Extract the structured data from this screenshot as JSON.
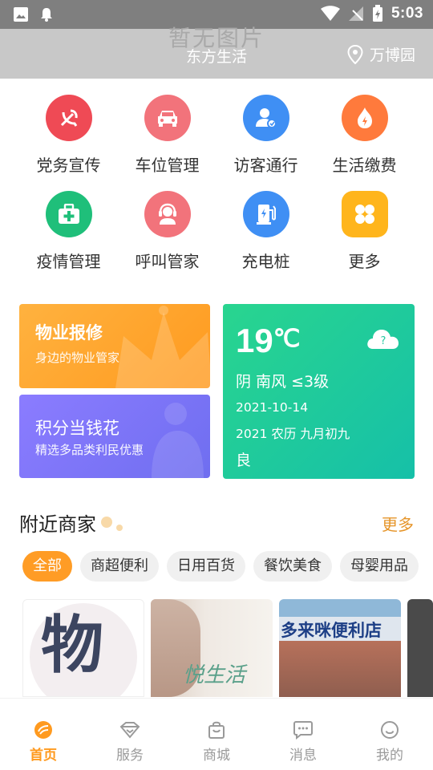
{
  "status_bar": {
    "time": "5:03"
  },
  "header": {
    "placeholder": "暂无图片",
    "title": "东方生活",
    "location": "万博园"
  },
  "grid": [
    {
      "label": "党务宣传",
      "icon": "party-emblem-icon",
      "color": "#ef4a55"
    },
    {
      "label": "车位管理",
      "icon": "car-icon",
      "color": "#f2737b"
    },
    {
      "label": "访客通行",
      "icon": "visitor-icon",
      "color": "#3f8ff4"
    },
    {
      "label": "生活缴费",
      "icon": "fire-icon",
      "color": "#ff7a3c"
    },
    {
      "label": "疫情管理",
      "icon": "medical-kit-icon",
      "color": "#1fbf7a"
    },
    {
      "label": "呼叫管家",
      "icon": "headset-icon",
      "color": "#f2737b"
    },
    {
      "label": "充电桩",
      "icon": "charger-icon",
      "color": "#3f8ff4"
    },
    {
      "label": "更多",
      "icon": "apps-icon",
      "color": "#ffb51c"
    }
  ],
  "cards": {
    "repair": {
      "title": "物业报修",
      "subtitle": "身边的物业管家"
    },
    "points": {
      "title": "积分当钱花",
      "subtitle": "精选多品类利民优惠"
    },
    "weather": {
      "temp": "19",
      "unit": "℃",
      "desc": "阴 南风 ≤3级",
      "date": "2021-10-14",
      "lunar": "2021 农历 九月初九",
      "quality": "良",
      "icon": "cloud-question-icon"
    }
  },
  "nearby": {
    "title": "附近商家",
    "more": "更多",
    "chips": [
      "全部",
      "商超便利",
      "日用百货",
      "餐饮美食",
      "母婴用品"
    ],
    "shops": [
      {
        "caption": "物"
      },
      {
        "caption": "悦生活"
      },
      {
        "caption": "多来咪便利店"
      }
    ]
  },
  "tabs": [
    {
      "label": "首页",
      "icon": "home-icon"
    },
    {
      "label": "服务",
      "icon": "service-icon"
    },
    {
      "label": "商城",
      "icon": "shop-bag-icon"
    },
    {
      "label": "消息",
      "icon": "message-icon"
    },
    {
      "label": "我的",
      "icon": "profile-icon"
    }
  ],
  "colors": {
    "accent": "#ff9a1f"
  }
}
